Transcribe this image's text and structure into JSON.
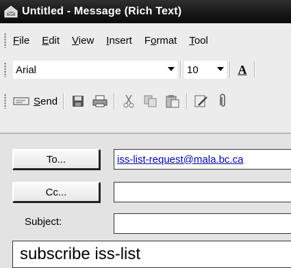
{
  "window": {
    "title": "Untitled - Message (Rich Text)"
  },
  "menubar": {
    "items": [
      {
        "accel": "F",
        "rest": "ile"
      },
      {
        "accel": "E",
        "rest": "dit"
      },
      {
        "accel": "V",
        "rest": "iew"
      },
      {
        "accel": "I",
        "rest": "nsert"
      },
      {
        "pre": "F",
        "accel": "o",
        "rest": "rmat"
      },
      {
        "accel": "T",
        "rest": "ool"
      }
    ]
  },
  "format_toolbar": {
    "font": "Arial",
    "size": "10",
    "font_color_glyph": "A"
  },
  "standard_toolbar": {
    "send_accel": "S",
    "send_rest": "end",
    "icons": [
      "send-icon",
      "save-icon",
      "print-icon",
      "cut-icon",
      "copy-icon",
      "paste-icon",
      "edit-icon",
      "attach-icon"
    ]
  },
  "address": {
    "to_button": "To...",
    "to_value": "iss-list-request@mala.bc.ca",
    "cc_button": "Cc...",
    "cc_value": "",
    "subject_label": "Subject:",
    "subject_value": ""
  },
  "body": {
    "text": "subscribe iss-list"
  }
}
